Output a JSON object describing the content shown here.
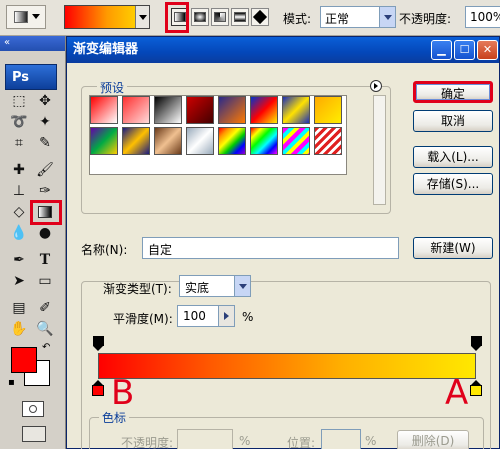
{
  "options_bar": {
    "mode_label": "模式:",
    "mode_value": "正常",
    "opacity_label": "不透明度:",
    "opacity_value": "100%"
  },
  "tools_panel": {
    "logo": "Ps"
  },
  "dialog": {
    "title": "渐变编辑器",
    "presets_label": "预设",
    "buttons": {
      "ok": "确定",
      "cancel": "取消",
      "load": "载入(L)...",
      "save": "存储(S)...",
      "new": "新建(W)",
      "delete": "删除(D)"
    },
    "name_label": "名称(N):",
    "name_value": "自定",
    "gradient_type_label": "渐变类型(T):",
    "gradient_type_value": "实底",
    "smoothness_label": "平滑度(M):",
    "smoothness_value": "100",
    "smoothness_unit": "%",
    "color_stops_label": "色标",
    "opacity_label": "不透明度:",
    "opacity_unit": "%",
    "location_label": "位置:",
    "location_unit": "%"
  },
  "annotations": {
    "left_stop": "B",
    "right_stop": "A"
  },
  "colors": {
    "gradient_start": "#ff0000",
    "gradient_end": "#ffe800",
    "foreground": "#ff0000",
    "highlight": "#e0001a"
  }
}
